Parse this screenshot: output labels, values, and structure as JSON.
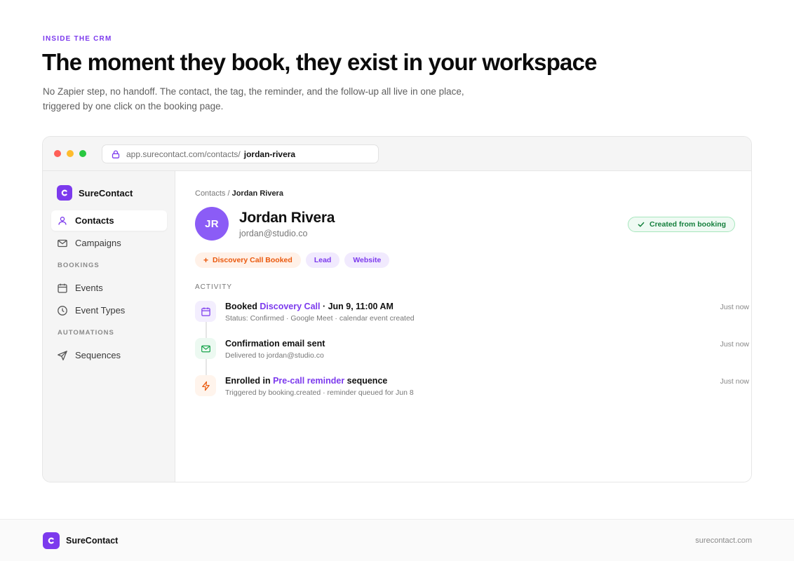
{
  "header": {
    "eyebrow": "INSIDE THE CRM",
    "headline": "The moment they book, they exist in your workspace",
    "subhead": "No Zapier step, no handoff. The contact, the tag, the reminder, and the follow-up all live in one place, triggered by one click on the booking page."
  },
  "browser": {
    "url_base": "app.surecontact.com/contacts/",
    "url_slug": "jordan-rivera"
  },
  "sidebar": {
    "brand": "SureContact",
    "items": [
      {
        "label": "Contacts",
        "icon": "user-icon",
        "active": true
      },
      {
        "label": "Campaigns",
        "icon": "mail-icon",
        "active": false
      }
    ],
    "section_bookings": "BOOKINGS",
    "bookings_items": [
      {
        "label": "Events",
        "icon": "calendar-icon"
      },
      {
        "label": "Event Types",
        "icon": "clock-icon"
      }
    ],
    "section_automations": "AUTOMATIONS",
    "automations_items": [
      {
        "label": "Sequences",
        "icon": "send-icon"
      }
    ]
  },
  "contact": {
    "breadcrumb_parent": "Contacts",
    "breadcrumb_sep": " / ",
    "breadcrumb_current": "Jordan Rivera",
    "initials": "JR",
    "name": "Jordan Rivera",
    "email": "jordan@studio.co",
    "status": "Created from booking",
    "tags": [
      "Discovery Call Booked",
      "Lead",
      "Website"
    ]
  },
  "activity": {
    "label": "ACTIVITY",
    "items": [
      {
        "title_pre": "Booked ",
        "title_link": "Discovery Call",
        "title_post": " · Jun 9, 11:00 AM",
        "sub": "Status: Confirmed · Google Meet · calendar event created",
        "time": "Just now",
        "icon": "calendar-icon"
      },
      {
        "title": "Confirmation email sent",
        "sub": "Delivered to jordan@studio.co",
        "time": "Just now",
        "icon": "mail-icon"
      },
      {
        "title_pre": "Enrolled in ",
        "title_link": "Pre-call reminder",
        "title_post": " sequence",
        "sub": "Triggered by booking.created · reminder queued for Jun 8",
        "time": "Just now",
        "icon": "lightning-icon"
      }
    ]
  },
  "footer": {
    "brand": "SureContact",
    "url": "surecontact.com"
  },
  "colors": {
    "accent": "#7c3aed",
    "success": "#15803d",
    "warning": "#ea580c"
  }
}
